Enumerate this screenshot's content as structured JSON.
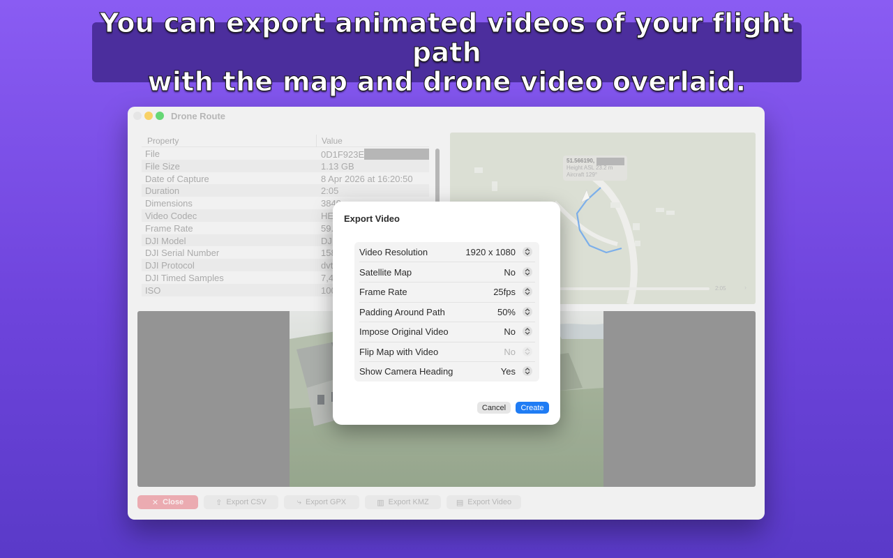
{
  "banner": {
    "line1": "You can export animated videos of your flight path",
    "line2": "with the map and drone video overlaid."
  },
  "window": {
    "title": "Drone Route",
    "table": {
      "col_property": "Property",
      "col_value": "Value",
      "rows": [
        {
          "k": "File",
          "v": "0D1F923E"
        },
        {
          "k": "File Size",
          "v": "1.13 GB"
        },
        {
          "k": "Date of Capture",
          "v": "8 Apr 2026 at 16:20:50"
        },
        {
          "k": "Duration",
          "v": "2:05"
        },
        {
          "k": "Dimensions",
          "v": "3840"
        },
        {
          "k": "Video Codec",
          "v": "HEVC"
        },
        {
          "k": "Frame Rate",
          "v": "59.9"
        },
        {
          "k": "DJI Model",
          "v": "DJI"
        },
        {
          "k": "DJI Serial Number",
          "v": "158"
        },
        {
          "k": "DJI Protocol",
          "v": "dvtm"
        },
        {
          "k": "DJI Timed Samples",
          "v": "7,48"
        },
        {
          "k": "ISO",
          "v": "100"
        }
      ]
    },
    "map": {
      "coord": "51.566190,",
      "height": "Height ASL 23.2 m",
      "aircraft": "Aircraft 129°",
      "time": "2:05"
    },
    "toolbar": {
      "close": "Close",
      "export_csv": "Export CSV",
      "export_gpx": "Export GPX",
      "export_kmz": "Export KMZ",
      "export_video": "Export Video"
    }
  },
  "dialog": {
    "title": "Export Video",
    "options": [
      {
        "label": "Video Resolution",
        "value": "1920 x 1080",
        "enabled": true
      },
      {
        "label": "Satellite Map",
        "value": "No",
        "enabled": true
      },
      {
        "label": "Frame Rate",
        "value": "25fps",
        "enabled": true
      },
      {
        "label": "Padding Around Path",
        "value": "50%",
        "enabled": true
      },
      {
        "label": "Impose Original Video",
        "value": "No",
        "enabled": true
      },
      {
        "label": "Flip Map with Video",
        "value": "No",
        "enabled": false
      },
      {
        "label": "Show Camera Heading",
        "value": "Yes",
        "enabled": true
      }
    ],
    "cancel": "Cancel",
    "create": "Create"
  },
  "colors": {
    "accent": "#1f7cf4",
    "close_button": "#e48b93",
    "route": "#4a90e2",
    "background_top": "#8a5cf3",
    "background_bottom": "#5a3ac8"
  }
}
